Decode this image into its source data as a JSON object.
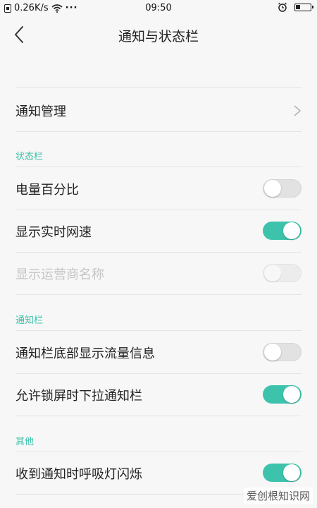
{
  "status_bar": {
    "network_speed": "0.26K/s",
    "more": "···",
    "time": "09:50"
  },
  "header": {
    "title": "通知与状态栏"
  },
  "rows": {
    "notification_management": "通知管理",
    "battery_percentage": "电量百分比",
    "realtime_speed": "显示实时网速",
    "carrier_name": "显示运营商名称",
    "traffic_info": "通知栏底部显示流量信息",
    "pull_down_lockscreen": "允许锁屏时下拉通知栏",
    "breathing_light": "收到通知时呼吸灯闪烁"
  },
  "toggles": {
    "battery_percentage": "off",
    "realtime_speed": "on",
    "carrier_name": "off (disabled)",
    "traffic_info": "off",
    "pull_down_lockscreen": "on",
    "breathing_light": "on"
  },
  "sections": {
    "status_bar": "状态栏",
    "notification_bar": "通知栏",
    "other": "其他"
  },
  "colors": {
    "accent": "#3dc3ac",
    "section_text": "#3bbfa9",
    "background": "#f7f7f7",
    "disabled_text": "#c4c4c4"
  },
  "icons": [
    "sim-icon",
    "wifi-icon",
    "alarm-icon",
    "battery-icon",
    "back-arrow-icon",
    "chevron-right-icon"
  ],
  "watermark": "爱创根知识网"
}
